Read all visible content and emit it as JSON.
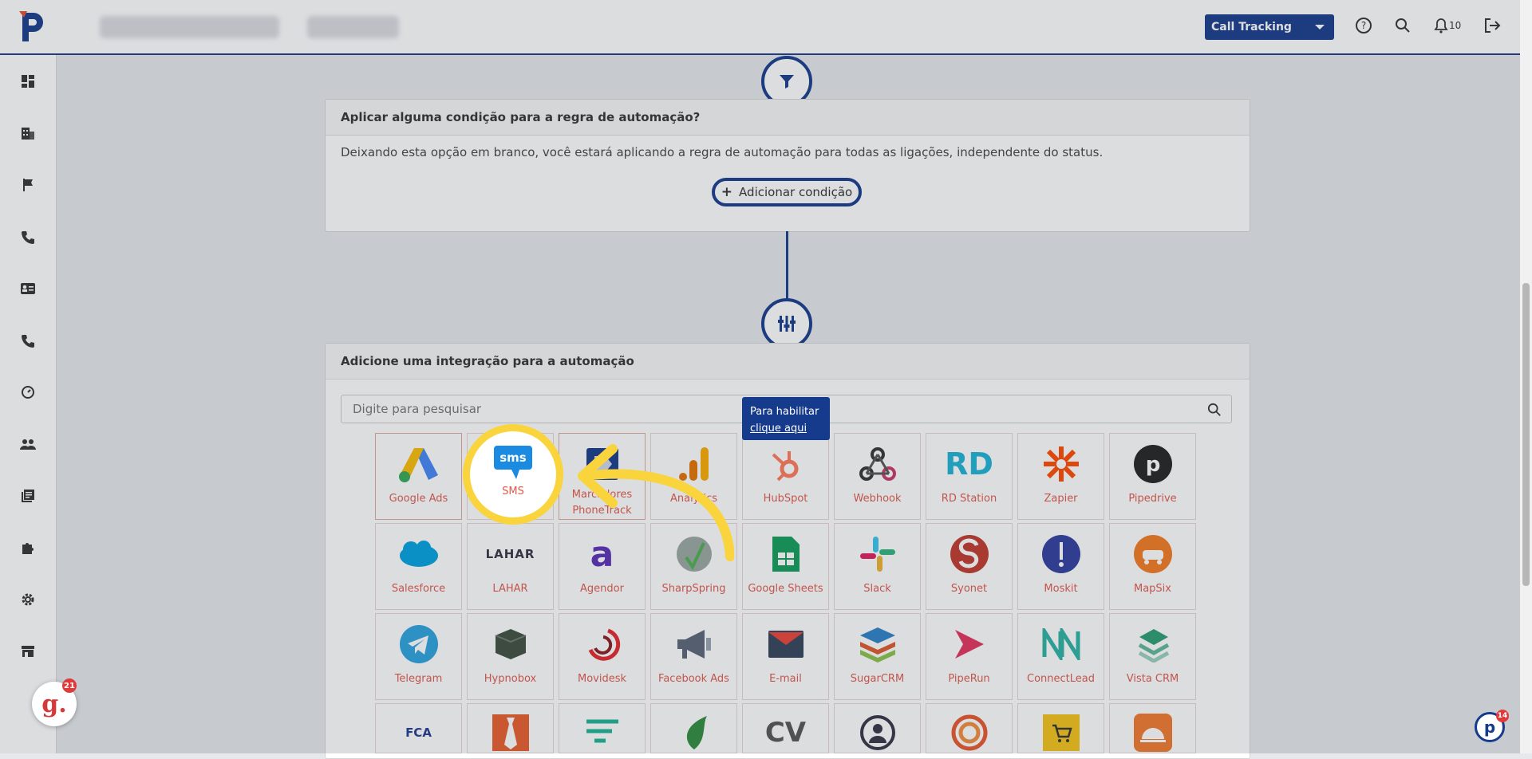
{
  "header": {
    "product_select": "Call Tracking",
    "notification_count": "10"
  },
  "condition_card": {
    "title": "Aplicar alguma condição para a regra de automação?",
    "description": "Deixando esta opção em branco, você estará aplicando a regra de automação para todas as ligações, independente do status.",
    "add_button": "Adicionar condição"
  },
  "integration_card": {
    "title": "Adicione uma integração para a automação",
    "search_placeholder": "Digite para pesquisar"
  },
  "tooltip": {
    "line1": "Para habilitar",
    "link": "clique aqui"
  },
  "integrations_row1": [
    "Google Ads",
    "SMS",
    "Marcadores PhoneTrack",
    "Analytics",
    "HubSpot",
    "Webhook",
    "RD Station",
    "Zapier",
    "Pipedrive"
  ],
  "integrations_row2": [
    "Salesforce",
    "LAHAR",
    "Agendor",
    "SharpSpring",
    "Google Sheets",
    "Slack",
    "Syonet",
    "Moskit",
    "MapSix"
  ],
  "integrations_row3": [
    "Telegram",
    "Hypnobox",
    "Movidesk",
    "Facebook Ads",
    "E-mail",
    "SugarCRM",
    "PipeRun",
    "ConnectLead",
    "Vista CRM"
  ],
  "chat_badge": "21",
  "support_badge": "14",
  "colors": {
    "primary": "#163b8c",
    "highlight": "#f9d43d",
    "label_red": "#e05a4c"
  }
}
